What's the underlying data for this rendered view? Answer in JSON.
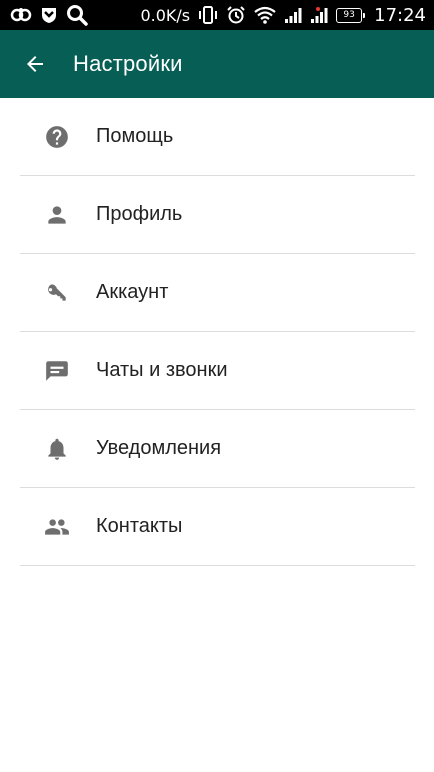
{
  "status_bar": {
    "speed": "0.0K/s",
    "battery": "93",
    "time": "17:24"
  },
  "app_bar": {
    "title": "Настройки",
    "color": "#075e54"
  },
  "settings": [
    {
      "label": "Помощь",
      "icon": "help-icon"
    },
    {
      "label": "Профиль",
      "icon": "person-icon"
    },
    {
      "label": "Аккаунт",
      "icon": "key-icon"
    },
    {
      "label": "Чаты и звонки",
      "icon": "chat-icon"
    },
    {
      "label": "Уведомления",
      "icon": "bell-icon"
    },
    {
      "label": "Контакты",
      "icon": "people-icon"
    }
  ],
  "colors": {
    "icon": "#6e6e6e",
    "divider": "#dcdcdc",
    "text": "#222222"
  }
}
